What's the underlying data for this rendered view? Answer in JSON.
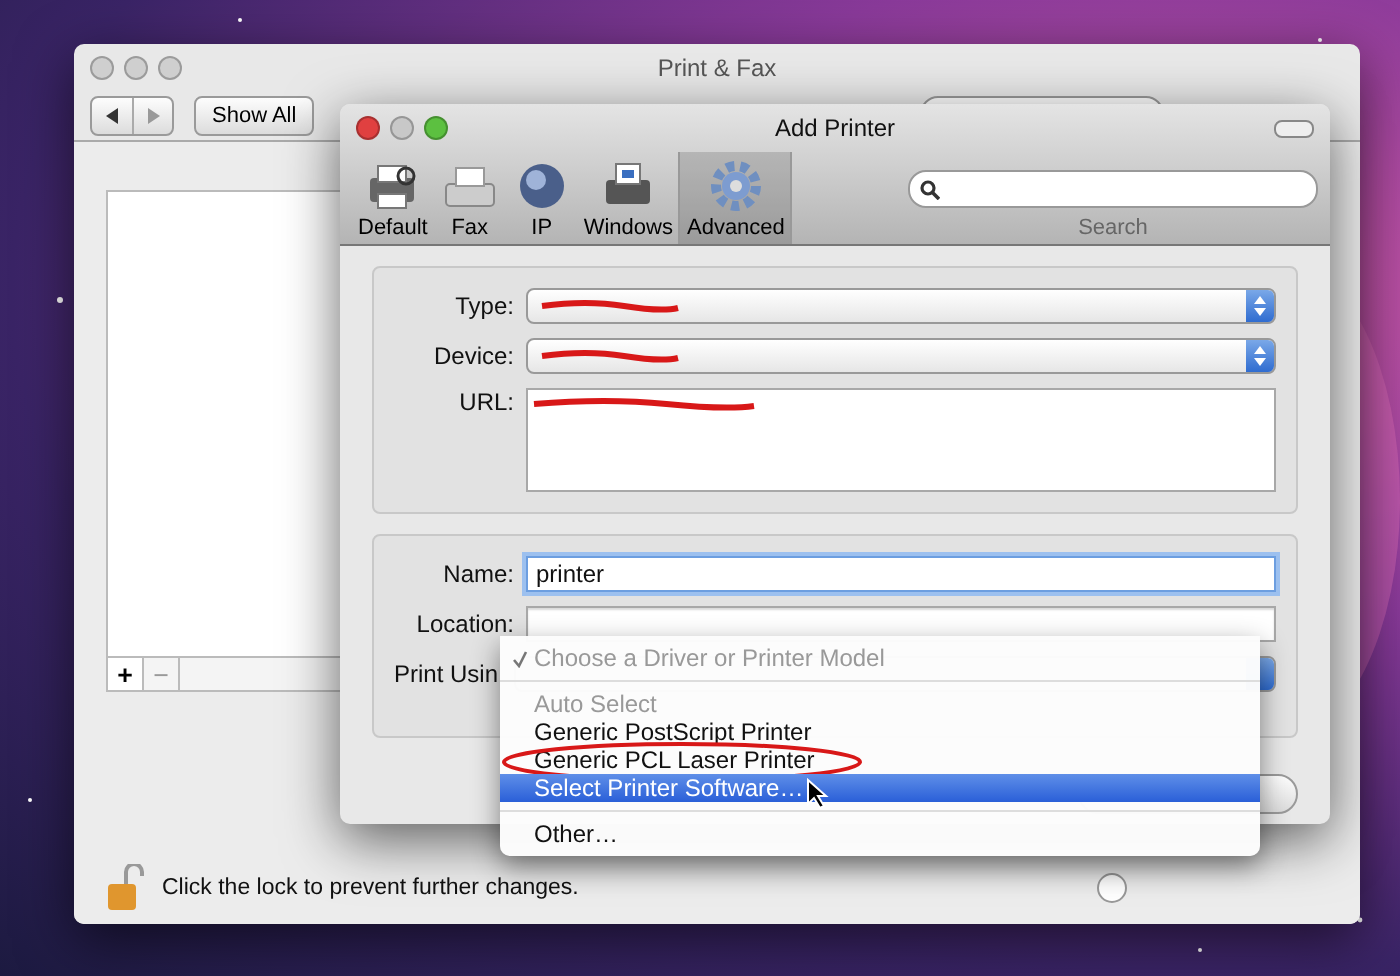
{
  "back_window": {
    "title": "Print & Fax",
    "show_all": "Show All",
    "add": "+",
    "remove": "−",
    "lock_text": "Click the lock to prevent further changes."
  },
  "add_printer": {
    "title": "Add Printer",
    "toolbar": [
      {
        "label": "Default",
        "selected": false
      },
      {
        "label": "Fax",
        "selected": false
      },
      {
        "label": "IP",
        "selected": false
      },
      {
        "label": "Windows",
        "selected": false
      },
      {
        "label": "Advanced",
        "selected": true
      }
    ],
    "search": {
      "label": "Search"
    },
    "connection": [
      {
        "label": "Type:",
        "kind": "popup",
        "redacted": true
      },
      {
        "label": "Device:",
        "kind": "popup",
        "redacted": true
      },
      {
        "label": "URL:",
        "kind": "textarea",
        "redacted": true
      }
    ],
    "name": {
      "label": "Name:",
      "value": "printer",
      "focused": true
    },
    "location": {
      "label": "Location:"
    },
    "print_using": {
      "label": "Print Usin"
    }
  },
  "menu": [
    {
      "kind": "item",
      "label": "Choose a Driver or Printer Model",
      "checked": true,
      "disabled": true,
      "selected": false,
      "circled": false
    },
    {
      "kind": "separator"
    },
    {
      "kind": "item",
      "label": "Auto Select",
      "checked": false,
      "disabled": true,
      "selected": false,
      "circled": false
    },
    {
      "kind": "item",
      "label": "Generic PostScript Printer",
      "checked": false,
      "disabled": false,
      "selected": false,
      "circled": false
    },
    {
      "kind": "item",
      "label": "Generic PCL Laser Printer",
      "checked": false,
      "disabled": false,
      "selected": false,
      "circled": true
    },
    {
      "kind": "item",
      "label": "Select Printer Software…",
      "checked": false,
      "disabled": false,
      "selected": true,
      "circled": false
    },
    {
      "kind": "separator"
    },
    {
      "kind": "item",
      "label": "Other…",
      "checked": false,
      "disabled": false,
      "selected": false,
      "circled": false
    }
  ]
}
